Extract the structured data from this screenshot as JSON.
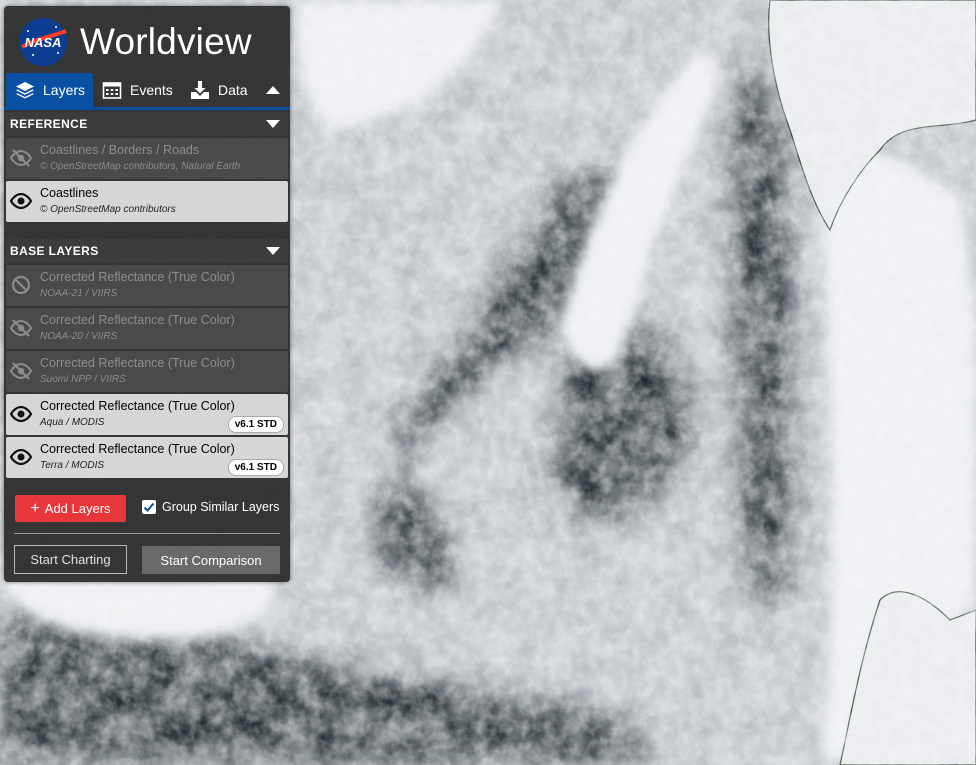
{
  "app": {
    "title": "Worldview",
    "logo_text": "NASA"
  },
  "tabs": [
    {
      "label": "Layers",
      "icon": "layers-icon",
      "active": true
    },
    {
      "label": "Events",
      "icon": "calendar-icon",
      "active": false
    },
    {
      "label": "Data",
      "icon": "download-icon",
      "active": false
    }
  ],
  "reference": {
    "header": "REFERENCE",
    "layers": [
      {
        "title": "Coastlines / Borders / Roads",
        "subtitle": "© OpenStreetMap contributors, Natural Earth",
        "state": "hidden"
      },
      {
        "title": "Coastlines",
        "subtitle": "© OpenStreetMap contributors",
        "state": "visible"
      }
    ]
  },
  "base": {
    "header": "BASE LAYERS",
    "layers": [
      {
        "title": "Corrected Reflectance (True Color)",
        "subtitle": "NOAA-21 / VIIRS",
        "state": "unavailable"
      },
      {
        "title": "Corrected Reflectance (True Color)",
        "subtitle": "NOAA-20 / VIIRS",
        "state": "hidden"
      },
      {
        "title": "Corrected Reflectance (True Color)",
        "subtitle": "Suomi NPP / VIIRS",
        "state": "hidden"
      },
      {
        "title": "Corrected Reflectance (True Color)",
        "subtitle": "Aqua / MODIS",
        "badge": "v6.1 STD",
        "state": "visible"
      },
      {
        "title": "Corrected Reflectance (True Color)",
        "subtitle": "Terra / MODIS",
        "badge": "v6.1 STD",
        "state": "visible"
      }
    ]
  },
  "footer": {
    "add_layers": "Add Layers",
    "group_similar": "Group Similar Layers",
    "group_similar_checked": true,
    "start_charting": "Start Charting",
    "start_comparison": "Start Comparison"
  },
  "colors": {
    "accent": "#0b51a3",
    "add_button": "#e8373b"
  }
}
